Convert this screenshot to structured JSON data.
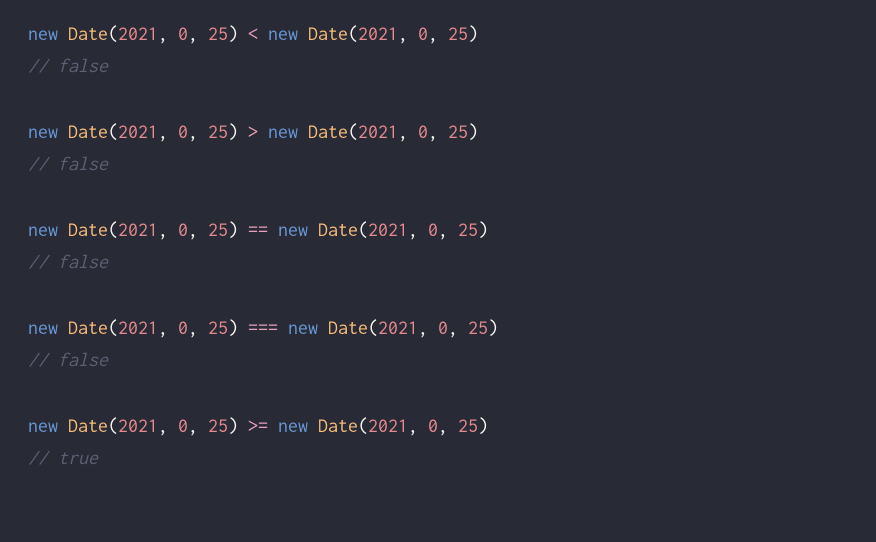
{
  "code": {
    "lines": [
      {
        "kw1": "new",
        "sp1": " ",
        "cls1": "Date",
        "lp1": "(",
        "n1": "2021",
        "c1": ", ",
        "n2": "0",
        "c2": ", ",
        "n3": "25",
        "rp1": ")",
        "sp2": " ",
        "op": "<",
        "sp3": " ",
        "kw2": "new",
        "sp4": " ",
        "cls2": "Date",
        "lp2": "(",
        "n4": "2021",
        "c3": ", ",
        "n5": "0",
        "c4": ", ",
        "n6": "25",
        "rp2": ")"
      },
      {
        "comment": "// false"
      },
      {
        "kw1": "new",
        "sp1": " ",
        "cls1": "Date",
        "lp1": "(",
        "n1": "2021",
        "c1": ", ",
        "n2": "0",
        "c2": ", ",
        "n3": "25",
        "rp1": ")",
        "sp2": " ",
        "op": ">",
        "sp3": " ",
        "kw2": "new",
        "sp4": " ",
        "cls2": "Date",
        "lp2": "(",
        "n4": "2021",
        "c3": ", ",
        "n5": "0",
        "c4": ", ",
        "n6": "25",
        "rp2": ")"
      },
      {
        "comment": "// false"
      },
      {
        "kw1": "new",
        "sp1": " ",
        "cls1": "Date",
        "lp1": "(",
        "n1": "2021",
        "c1": ", ",
        "n2": "0",
        "c2": ", ",
        "n3": "25",
        "rp1": ")",
        "sp2": " ",
        "op": "==",
        "sp3": " ",
        "kw2": "new",
        "sp4": " ",
        "cls2": "Date",
        "lp2": "(",
        "n4": "2021",
        "c3": ", ",
        "n5": "0",
        "c4": ", ",
        "n6": "25",
        "rp2": ")"
      },
      {
        "comment": "// false"
      },
      {
        "kw1": "new",
        "sp1": " ",
        "cls1": "Date",
        "lp1": "(",
        "n1": "2021",
        "c1": ", ",
        "n2": "0",
        "c2": ", ",
        "n3": "25",
        "rp1": ")",
        "sp2": " ",
        "op": "===",
        "sp3": " ",
        "kw2": "new",
        "sp4": " ",
        "cls2": "Date",
        "lp2": "(",
        "n4": "2021",
        "c3": ", ",
        "n5": "0",
        "c4": ", ",
        "n6": "25",
        "rp2": ")"
      },
      {
        "comment": "// false"
      },
      {
        "kw1": "new",
        "sp1": " ",
        "cls1": "Date",
        "lp1": "(",
        "n1": "2021",
        "c1": ", ",
        "n2": "0",
        "c2": ", ",
        "n3": "25",
        "rp1": ")",
        "sp2": " ",
        "op": ">=",
        "sp3": " ",
        "kw2": "new",
        "sp4": " ",
        "cls2": "Date",
        "lp2": "(",
        "n4": "2021",
        "c3": ", ",
        "n5": "0",
        "c4": ", ",
        "n6": "25",
        "rp2": ")"
      },
      {
        "comment": "// true"
      }
    ]
  }
}
